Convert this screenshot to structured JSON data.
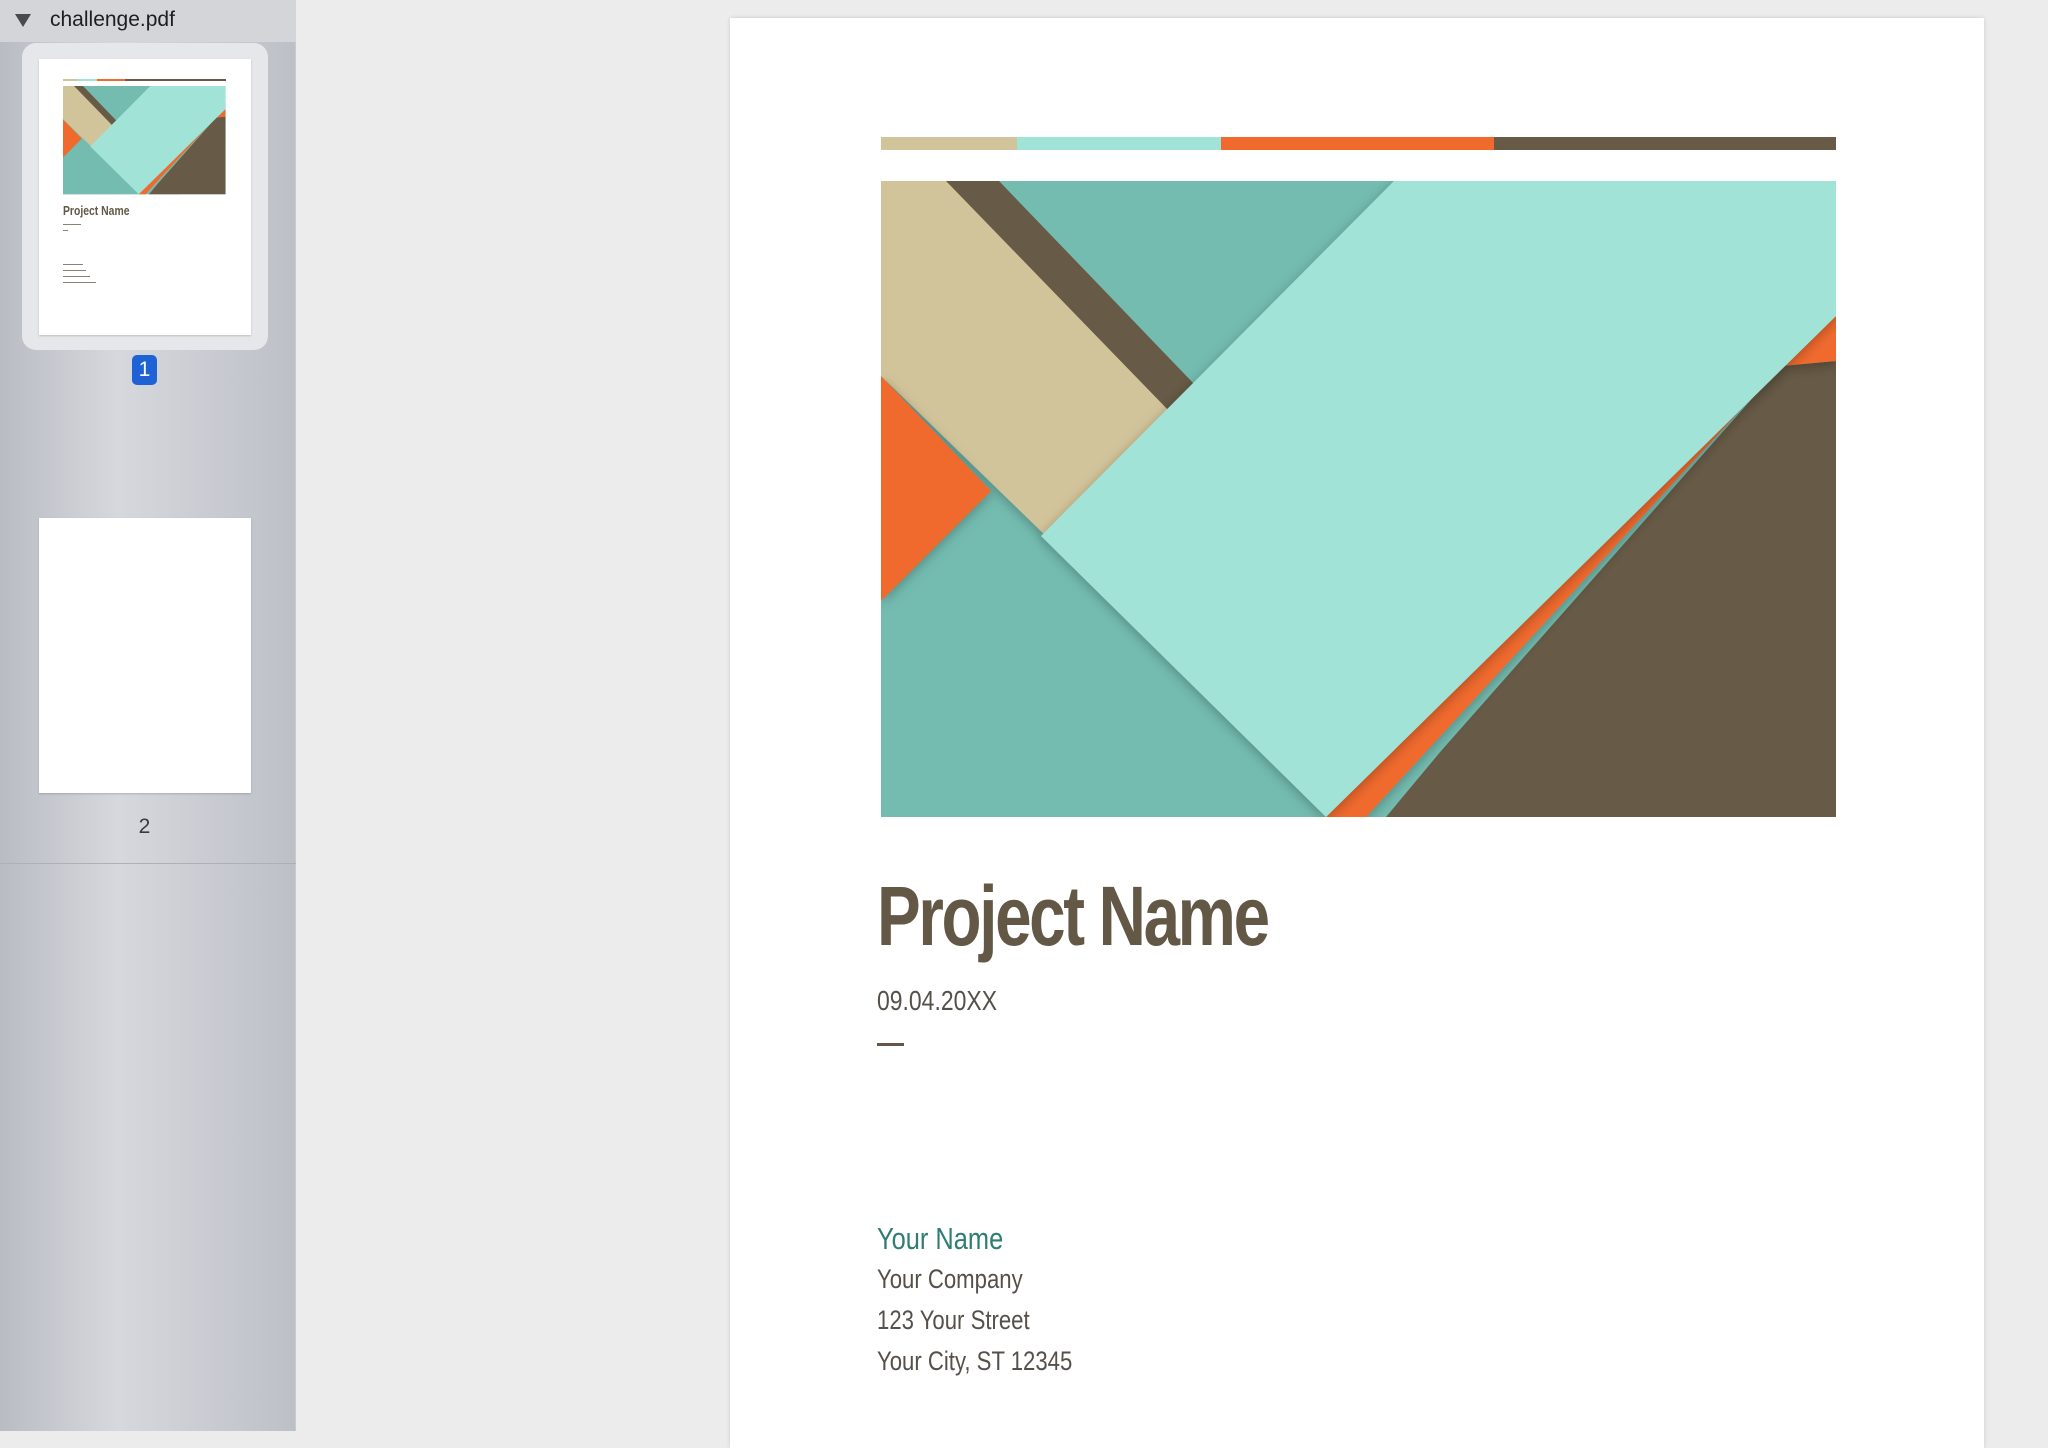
{
  "sidebar": {
    "file_name": "challenge.pdf",
    "pages": [
      {
        "number": "1",
        "selected": true
      },
      {
        "number": "2",
        "selected": false
      }
    ],
    "thumbnail_title": "Project Name"
  },
  "document": {
    "title": "Project Name",
    "date": "09.04.20XX",
    "author": {
      "name": "Your Name",
      "address_lines": [
        "Your Company",
        "123 Your Street",
        "Your City, ST 12345"
      ]
    }
  },
  "colors": {
    "title_brown": "#625845",
    "teal_name": "#2f7d73",
    "text_gray": "#55504a",
    "tan": "#d2c49a",
    "aqua": "#a1e3d7",
    "teal": "#74bcb0",
    "orange": "#f06a2e",
    "brown": "#675a46",
    "selection_blue": "#1f62d6"
  },
  "icons": {
    "disclosure": "disclosure-triangle-down-icon"
  }
}
